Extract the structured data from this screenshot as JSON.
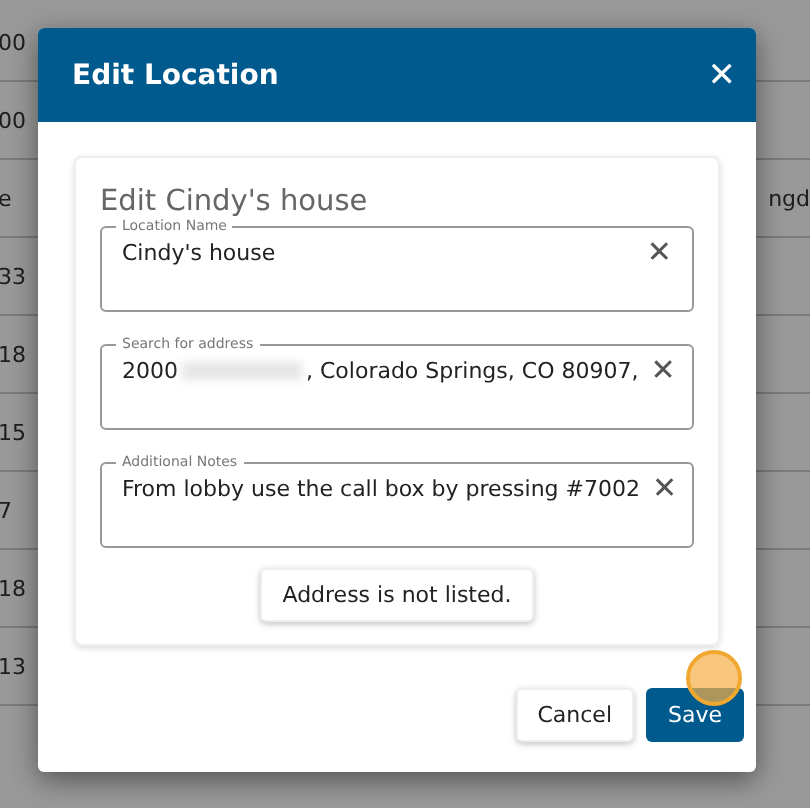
{
  "background_table": {
    "rows": [
      {
        "column_1": "00"
      },
      {
        "column_1": "00"
      },
      {
        "column_1": "e",
        "column_2": "ngd"
      },
      {
        "column_1": "33"
      },
      {
        "column_1": "18"
      },
      {
        "column_1": "15"
      },
      {
        "column_1": "7"
      },
      {
        "column_1": "18"
      },
      {
        "column_1": "13"
      }
    ]
  },
  "dialog": {
    "title": "Edit Location",
    "close": "✕",
    "heading": "Edit Cindy's house",
    "fields": [
      {
        "label": "Location Name",
        "value_parts": [
          "Cindy's house"
        ],
        "clear": "✕"
      },
      {
        "label": "Search for address",
        "value_parts": [
          "2000",
          ", Colorado Springs, CO 80907,"
        ],
        "blurred": true,
        "clear": "✕"
      },
      {
        "label": "Additional Notes",
        "value_parts": [
          "From lobby use the call box by pressing #7002"
        ],
        "clear": "✕"
      }
    ],
    "unlisted_button": "Address is not listed.",
    "buttons": [
      {
        "label": "Cancel",
        "kind": "secondary"
      },
      {
        "label": "Save",
        "kind": "primary",
        "click_marker": true
      }
    ]
  }
}
